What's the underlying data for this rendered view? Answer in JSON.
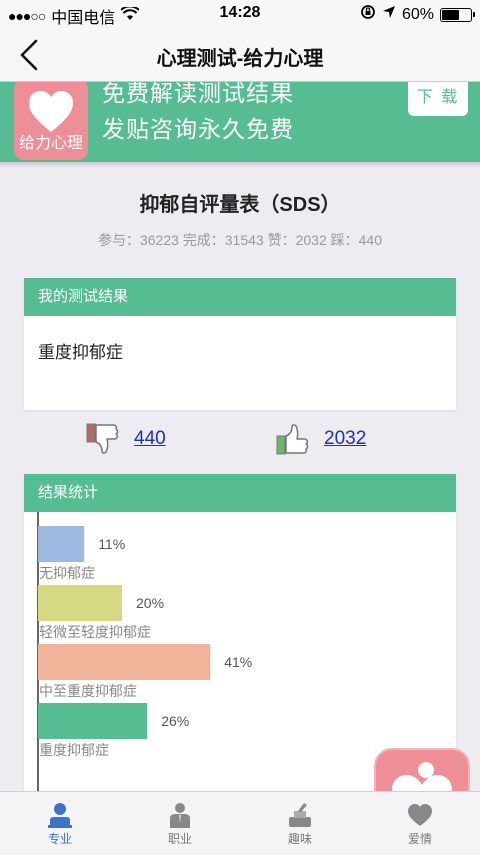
{
  "status_bar": {
    "signal": "●●●○○",
    "carrier": "中国电信",
    "time": "14:28",
    "battery": "60%",
    "battery_level": 0.6
  },
  "nav": {
    "title": "心理测试-给力心理"
  },
  "banner": {
    "app_name": "给力心理",
    "line1": "免费解读测试结果",
    "line2": "发贴咨询永久免费",
    "download_label": "下 载"
  },
  "test": {
    "title": "抑郁自评量表（SDS）",
    "stats": "参与：36223 完成：31543 赞：2032 踩：440"
  },
  "my_result": {
    "header": "我的测试结果",
    "value": "重度抑郁症"
  },
  "votes": {
    "dislike": "440",
    "like": "2032"
  },
  "stats_card": {
    "header": "结果统计"
  },
  "chart_data": {
    "type": "bar",
    "orientation": "horizontal",
    "categories": [
      "无抑郁症",
      "轻微至轻度抑郁症",
      "中至重度抑郁症",
      "重度抑郁症"
    ],
    "values": [
      11,
      20,
      41,
      26
    ],
    "value_labels": [
      "11%",
      "20%",
      "41%",
      "26%"
    ],
    "colors": [
      "#9fb8e0",
      "#d6d983",
      "#f0b49a",
      "#56bd92"
    ],
    "xlim": [
      0,
      100
    ]
  },
  "tabs": [
    {
      "label": "专业",
      "icon": "professional-icon",
      "active": true
    },
    {
      "label": "职业",
      "icon": "career-icon",
      "active": false
    },
    {
      "label": "趣味",
      "icon": "fun-icon",
      "active": false
    },
    {
      "label": "爱情",
      "icon": "love-icon",
      "active": false
    }
  ],
  "colors": {
    "accent_green": "#56bd92",
    "brand_pink": "#ee8f98",
    "link_blue": "#1a2fc9",
    "tab_active": "#3b73c8"
  }
}
